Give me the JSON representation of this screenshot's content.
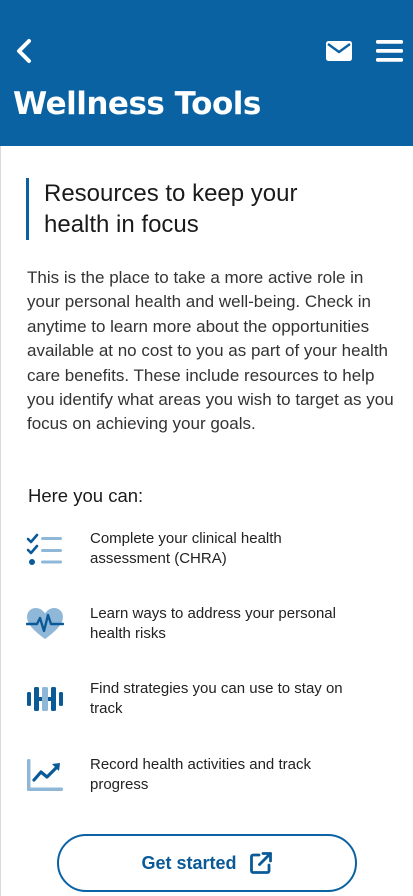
{
  "header": {
    "title": "Wellness Tools",
    "background": "#0b62a3",
    "icons": {
      "back": "chevron-left-icon",
      "mail": "envelope-icon",
      "menu": "hamburger-menu-icon"
    }
  },
  "main": {
    "heading": "Resources to keep your health in focus",
    "intro": "This is the place to take a more active role in your personal health and well-being. Check in anytime to learn more about the opportunities available at no cost to you as part of your health care benefits. These include resources to help you identify what areas you wish to target as you focus on achieving your goals.",
    "here_label": "Here you can:",
    "features": [
      {
        "icon": "checklist-icon",
        "text": "Complete your clinical health assessment (CHRA)"
      },
      {
        "icon": "heart-pulse-icon",
        "text": "Learn ways to address your personal health risks"
      },
      {
        "icon": "dumbbell-icon",
        "text": "Find strategies you can use to stay on track"
      },
      {
        "icon": "trend-chart-icon",
        "text": "Record health activities and track progress"
      }
    ],
    "cta": {
      "label": "Get started",
      "icon": "external-link-icon"
    }
  },
  "colors": {
    "brand": "#0b62a3",
    "icon_dark": "#0b5a98",
    "icon_light": "#8fb8d8"
  }
}
